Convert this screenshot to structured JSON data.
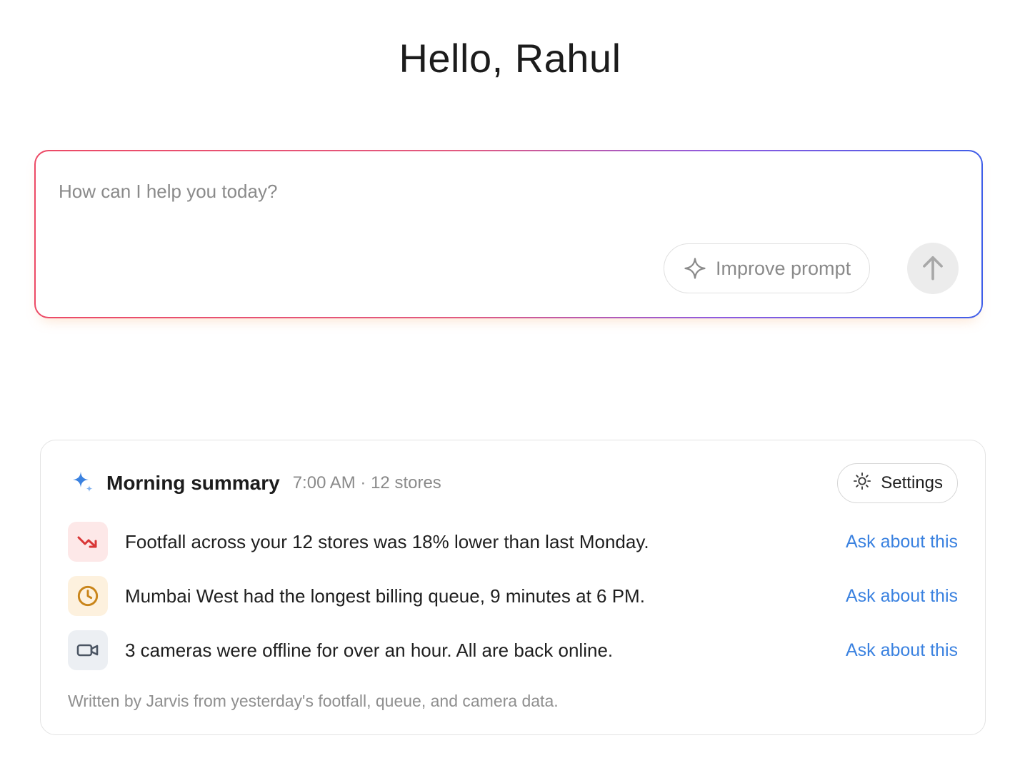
{
  "greeting": "Hello, Rahul",
  "prompt": {
    "placeholder": "How can I help you today?",
    "value": "",
    "improve_label": "Improve prompt",
    "send_icon": "arrow-up-icon"
  },
  "summary": {
    "title": "Morning summary",
    "meta": "7:00 AM · 12 stores",
    "settings_label": "Settings",
    "items": [
      {
        "icon": "trending-down-icon",
        "text": "Footfall across your 12 stores was 18% lower than last Monday.",
        "action": "Ask about this"
      },
      {
        "icon": "clock-icon",
        "text": "Mumbai West had the longest billing queue, 9 minutes at 6 PM.",
        "action": "Ask about this"
      },
      {
        "icon": "video-camera-icon",
        "text": "3 cameras were offline for over an hour. All are back online.",
        "action": "Ask about this"
      }
    ],
    "footer": "Written by Jarvis from yesterday's footfall, queue, and camera data."
  },
  "colors": {
    "accent_link": "#3b82e0",
    "gradient_start": "#ec4a66",
    "gradient_end": "#3f5ee8",
    "down_icon": "#d93636",
    "clock_icon": "#c9851a",
    "camera_icon": "#4b5563"
  }
}
